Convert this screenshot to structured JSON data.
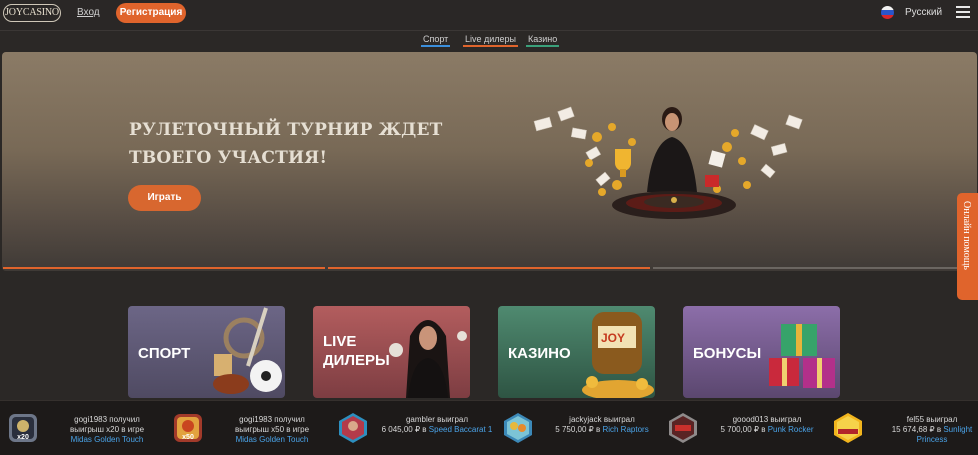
{
  "header": {
    "logo_text": "JOYCASINO",
    "login_label": "Вход",
    "register_label": "Регистрация",
    "language": "Русский"
  },
  "tabs": [
    {
      "label": "Спорт",
      "color": "#3b8fdc"
    },
    {
      "label": "Live дилеры",
      "color": "#e0642c"
    },
    {
      "label": "Казино",
      "color": "#3aa07a"
    }
  ],
  "hero": {
    "title_line1": "РУЛЕТОЧНЫЙ ТУРНИР ЖДЕТ",
    "title_line2": "ТВОЕГО УЧАСТИЯ!",
    "play_label": "Играть"
  },
  "help_label": "Онлайн помощь",
  "categories": [
    {
      "label": "СПОРТ",
      "color": "#5f5a7b"
    },
    {
      "label": "LIVE\nДИЛЕРЫ",
      "color": "#a04f52"
    },
    {
      "label": "КАЗИНО",
      "color": "#3f6d58"
    },
    {
      "label": "БОНУСЫ",
      "color": "#7d5f96"
    }
  ],
  "winners": [
    {
      "line1": "gogi1983 получил",
      "line2": "выигрыш x20 в игре",
      "game": "Midas Golden Touch",
      "badge": "x20"
    },
    {
      "line1": "gogi1983 получил",
      "line2": "выигрыш x50 в игре",
      "game": "Midas Golden Touch",
      "badge": "x50"
    },
    {
      "line1": "gambler выиграл",
      "line2": "6 045,00 ₽ в",
      "game": "Speed Baccarat 1",
      "badge": ""
    },
    {
      "line1": "jackyjack выиграл",
      "line2": "5 750,00 ₽ в",
      "game": "Rich Raptors",
      "badge": ""
    },
    {
      "line1": "goood013 выиграл",
      "line2": "5 700,00 ₽ в",
      "game": "Punk Rocker",
      "badge": ""
    },
    {
      "line1": "fel55 выиграл",
      "line2": "15 674,68 ₽ в",
      "game": "Sunlight Princess",
      "badge": ""
    }
  ]
}
